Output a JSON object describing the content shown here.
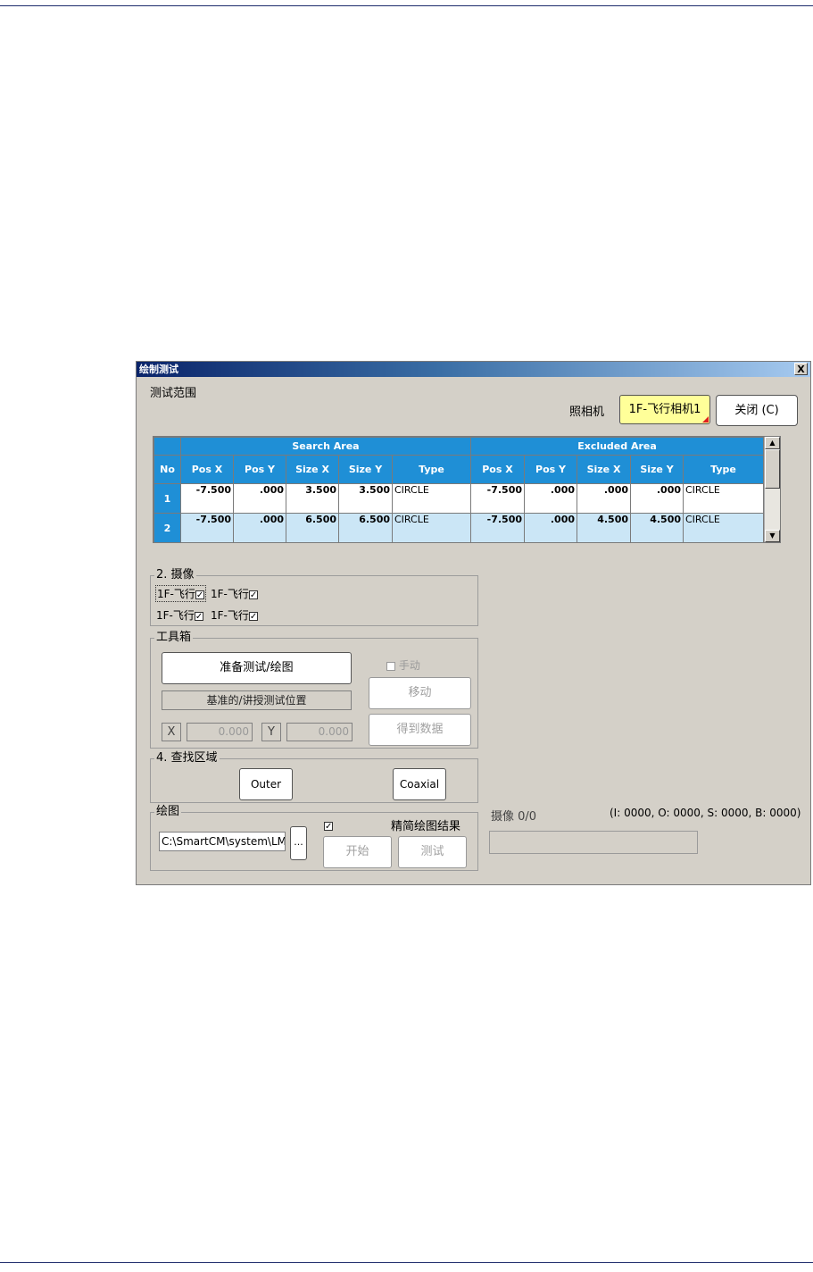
{
  "window": {
    "title": "绘制测试",
    "close_glyph": "X",
    "test_range_label": "测试范围",
    "camera_label": "照相机",
    "camera_button": "1F-飞行相机1",
    "close_button": "关闭 (C)"
  },
  "grid": {
    "group_headers": [
      "Search Area",
      "Excluded Area"
    ],
    "columns": [
      "No",
      "Pos X",
      "Pos Y",
      "Size X",
      "Size Y",
      "Type",
      "Pos X",
      "Pos Y",
      "Size X",
      "Size Y",
      "Type"
    ],
    "rows": [
      [
        "1",
        "-7.500",
        ".000",
        "3.500",
        "3.500",
        "CIRCLE",
        "-7.500",
        ".000",
        ".000",
        ".000",
        "CIRCLE"
      ],
      [
        "2",
        "-7.500",
        ".000",
        "6.500",
        "6.500",
        "CIRCLE",
        "-7.500",
        ".000",
        "4.500",
        "4.500",
        "CIRCLE"
      ]
    ]
  },
  "camera_group": {
    "title": "2. 摄像",
    "items": [
      "1F-飞行",
      "1F-飞行",
      "1F-飞行",
      "1F-飞行"
    ],
    "check_glyph": "✓"
  },
  "toolbox": {
    "title": "工具箱",
    "prepare_button": "准备测试/绘图",
    "manual_label": "手动",
    "move_button": "移动",
    "reference_label": "基准的/讲授测试位置",
    "x_label": "X",
    "x_value": "0.000",
    "y_label": "Y",
    "y_value": "0.000",
    "get_data_button": "得到数据"
  },
  "search_area": {
    "title": "4. 查找区域",
    "outer_button": "Outer",
    "coaxial_button": "Coaxial"
  },
  "drawing": {
    "title": "绘图",
    "path": "C:\\SmartCM\\system\\LM_f",
    "browse_button": "...",
    "simplify_check": "✓",
    "simplify_label": "精简绘图结果",
    "start_button": "开始",
    "test_button": "测试"
  },
  "status": {
    "camera_counter": "摄像 0/0",
    "stats": "(I: 0000, O: 0000, S: 0000, B: 0000)"
  }
}
